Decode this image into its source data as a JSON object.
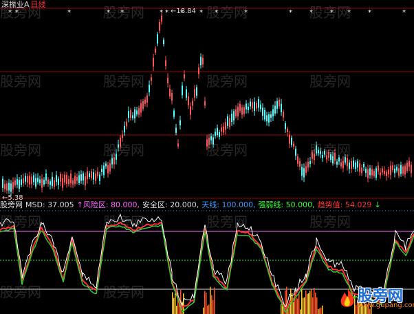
{
  "header": {
    "title_left": "深振业A",
    "title_period": "日线"
  },
  "price_chart": {
    "high_label": "←18.84",
    "low_label": "←5.38",
    "up_color": "#ff5555",
    "down_color": "#54ffff",
    "grid_color": "#a00000"
  },
  "indicator": {
    "prefix": "股旁网",
    "msd": "MSD: 37.005",
    "risk": "↑风险区: 80.000,",
    "safe": "安全区: 20.000,",
    "sky": "天线: 100.000,",
    "strong": "强弱线: 50.000,",
    "trend": "趋势值: 54.029",
    "arrow": "↓",
    "risk_color": "#ff66ff",
    "safe_color": "#dcdcdc",
    "sky_color": "#3f9bff",
    "strong_color": "#33ff33",
    "trend_color": "#ff3333"
  },
  "watermarks": [
    "股旁网",
    "股旁网",
    "股旁网",
    "股旁网",
    "股旁网",
    "股旁网",
    "股旁网",
    "股旁网",
    "股旁网",
    "股旁网",
    "股旁网",
    "股旁网",
    "股旁网",
    "股旁网",
    "股旁网",
    "股旁网",
    "股旁网",
    "股旁网"
  ],
  "brand": {
    "name": "股旁网",
    "url": "www.gupang.com"
  }
}
